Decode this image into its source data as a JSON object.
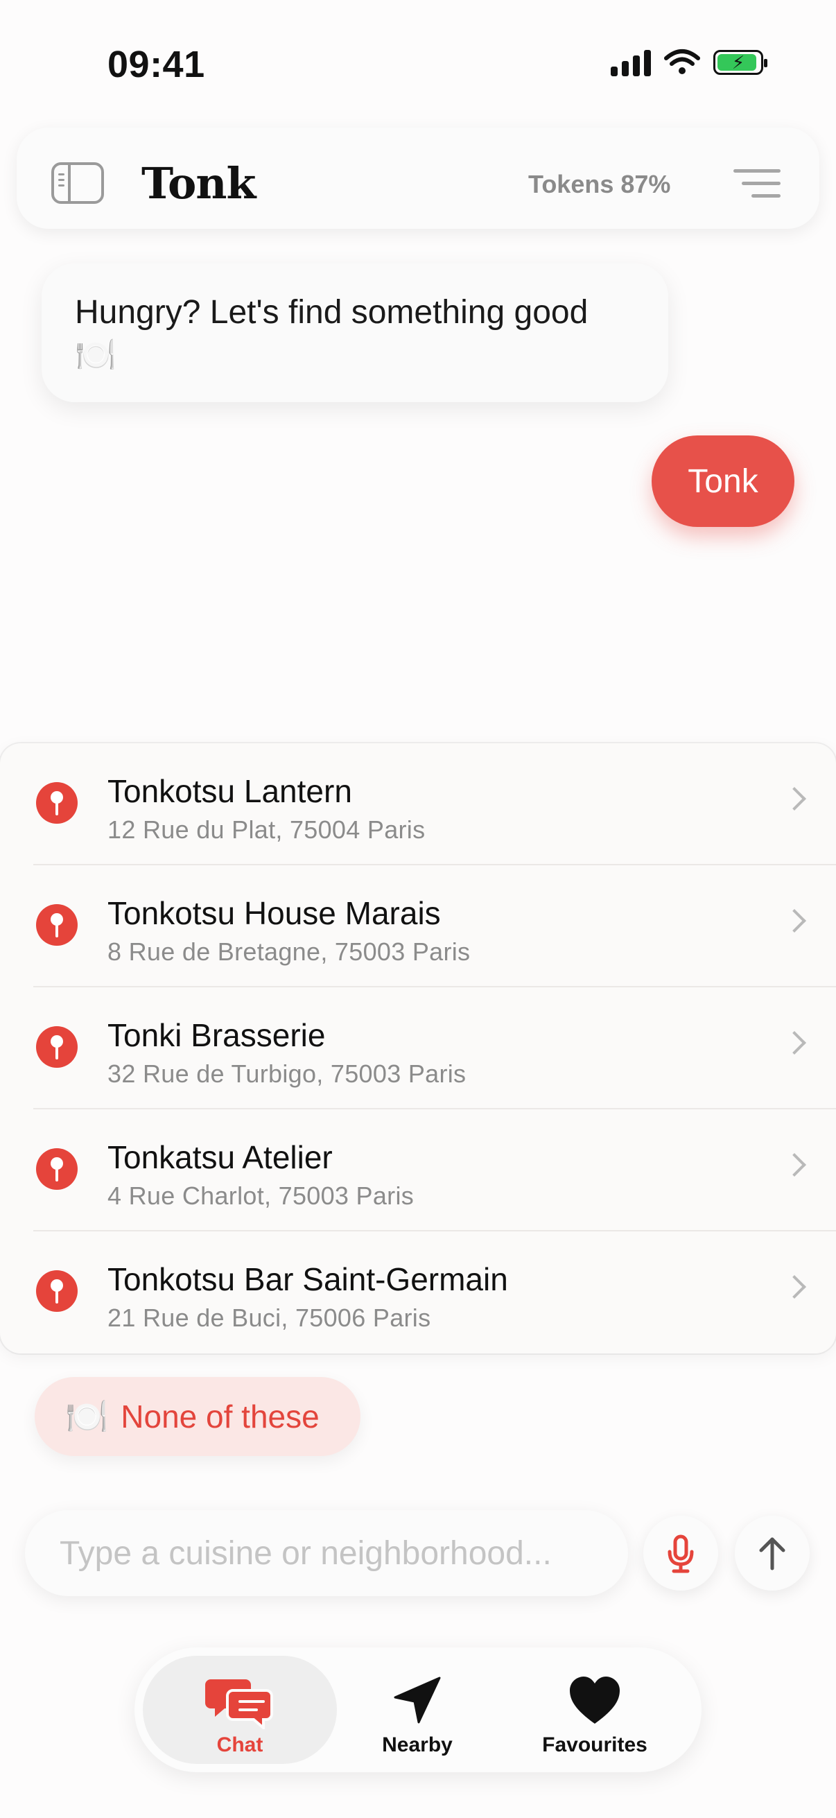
{
  "status_bar": {
    "time": "09:41"
  },
  "header": {
    "title": "Tonk",
    "tokens": "Tokens 87%"
  },
  "chat": {
    "bot_message": "Hungry? Let's find something good 🍽️",
    "user_message": "Tonk"
  },
  "results": [
    {
      "name": "Tonkotsu Lantern",
      "address": "12 Rue du Plat, 75004 Paris"
    },
    {
      "name": "Tonkotsu House Marais",
      "address": "8 Rue de Bretagne, 75003 Paris"
    },
    {
      "name": "Tonki Brasserie",
      "address": "32 Rue de Turbigo, 75003 Paris"
    },
    {
      "name": "Tonkatsu Atelier",
      "address": "4 Rue Charlot, 75003 Paris"
    },
    {
      "name": "Tonkotsu Bar Saint-Germain",
      "address": "21 Rue de Buci, 75006 Paris"
    }
  ],
  "none_chip": {
    "emoji": "🍽️",
    "label": "None of these"
  },
  "input": {
    "placeholder": "Type a cuisine or neighborhood...",
    "value": ""
  },
  "tabs": [
    {
      "label": "Chat",
      "icon": "chat-icon",
      "active": true
    },
    {
      "label": "Nearby",
      "icon": "location-arrow-icon",
      "active": false
    },
    {
      "label": "Favourites",
      "icon": "heart-icon",
      "active": false
    }
  ],
  "colors": {
    "accent": "#e5443b",
    "chip_bg": "#fbe7e5",
    "battery": "#34c759"
  }
}
